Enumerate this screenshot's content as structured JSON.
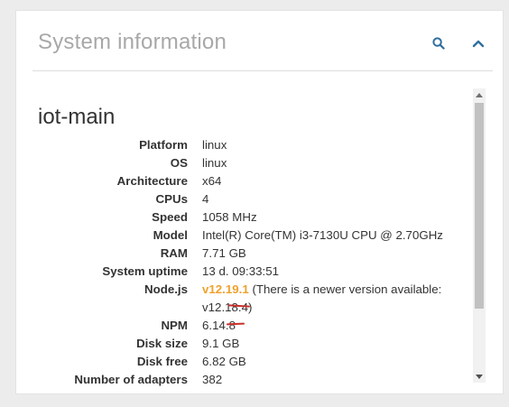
{
  "panel": {
    "title": "System information",
    "search_icon": "search-icon",
    "collapse_icon": "chevron-up-icon",
    "accent_color": "#2f6f9f"
  },
  "host": {
    "name": "iot-main"
  },
  "rows": {
    "platform": {
      "label": "Platform",
      "value": "linux"
    },
    "os": {
      "label": "OS",
      "value": "linux"
    },
    "arch": {
      "label": "Architecture",
      "value": "x64"
    },
    "cpus": {
      "label": "CPUs",
      "value": "4"
    },
    "speed": {
      "label": "Speed",
      "value": "1058 MHz"
    },
    "model": {
      "label": "Model",
      "value": "Intel(R) Core(TM) i3-7130U CPU @ 2.70GHz"
    },
    "ram": {
      "label": "RAM",
      "value": "7.71 GB"
    },
    "uptime": {
      "label": "System uptime",
      "value": "13 d. 09:33:51"
    },
    "node": {
      "label": "Node.js",
      "version": "v12.19.1",
      "notice_line1": " (There is a newer version available:",
      "notice_line2": "v12.18.4)"
    },
    "npm": {
      "label": "NPM",
      "value": "6.14.8"
    },
    "disk_size": {
      "label": "Disk size",
      "value": "9.1 GB"
    },
    "disk_free": {
      "label": "Disk free",
      "value": "6.82 GB"
    },
    "adapters": {
      "label": "Number of adapters",
      "value": "382"
    }
  },
  "colors": {
    "version_highlight": "#f0a12c",
    "annotation_underline": "#c9302c"
  }
}
